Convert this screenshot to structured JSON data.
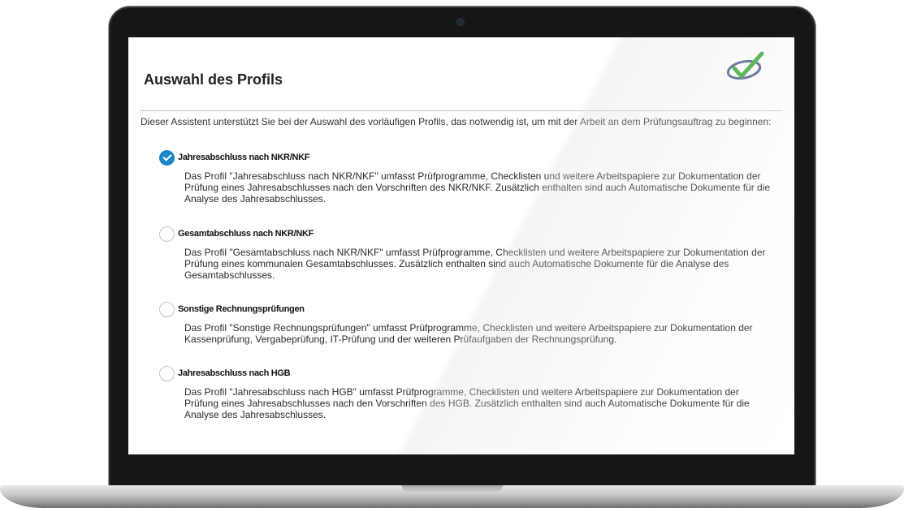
{
  "page": {
    "title": "Auswahl des Profils",
    "intro": "Dieser Assistent unterstützt Sie bei der Auswahl des vorläufigen Profils, das notwendig ist, um mit der Arbeit an dem Prüfungsauftrag zu beginnen:"
  },
  "options": [
    {
      "label": "Jahresabschluss nach NKR/NKF",
      "selected": true,
      "description": "Das Profil \"Jahresabschluss nach NKR/NKF\" umfasst Prüfprogramme, Checklisten und weitere Arbeitspapiere zur Dokumentation der Prüfung eines Jahresabschlusses nach den Vorschriften des NKR/NKF. Zusätzlich enthalten sind auch Automatische Dokumente für die Analyse des Jahresabschlusses."
    },
    {
      "label": "Gesamtabschluss nach NKR/NKF",
      "selected": false,
      "description": "Das Profil \"Gesamtabschluss nach NKR/NKF\" umfasst Prüfprogramme, Checklisten und weitere Arbeitspapiere zur Dokumentation der Prüfung eines kommunalen Gesamtabschlusses. Zusätzlich enthalten sind auch Automatische Dokumente für die Analyse des Gesamtabschlusses."
    },
    {
      "label": "Sonstige Rechnungsprüfungen",
      "selected": false,
      "description": "Das Profil \"Sonstige Rechnungsprüfungen\" umfasst Prüfprogramme, Checklisten und weitere Arbeitspapiere zur Dokumentation der Kassenprüfung, Vergabeprüfung, IT-Prüfung und der weiteren Prüfaufgaben der Rechnungsprüfung."
    },
    {
      "label": "Jahresabschluss nach HGB",
      "selected": false,
      "description": "Das Profil \"Jahresabschluss nach HGB\" umfasst Prüfprogramme, Checklisten und weitere Arbeitspapiere zur Dokumentation der Prüfung eines Jahresabschlusses nach den Vorschriften des HGB. Zusätzlich enthalten sind auch Automatische Dokumente für die Analyse des Jahresabschlusses."
    }
  ],
  "colors": {
    "accent": "#1b86c8",
    "logo_check": "#3aa832",
    "logo_ring": "#4a5a8a"
  },
  "icons": {
    "logo": "checkmark-oval-logo-icon",
    "selected_radio": "check-icon"
  }
}
